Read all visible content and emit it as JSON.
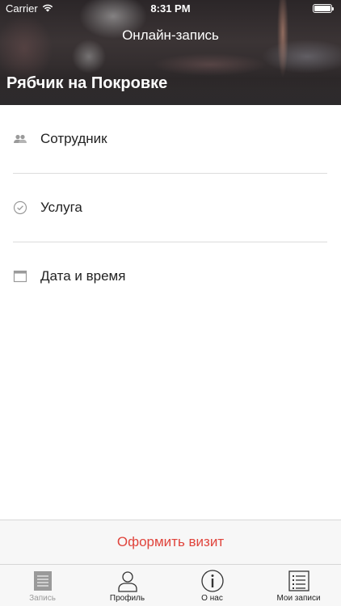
{
  "status_bar": {
    "carrier": "Carrier",
    "time": "8:31 PM",
    "wifi_icon": "wifi-icon",
    "battery_icon": "battery-icon"
  },
  "header": {
    "nav_title": "Онлайн-запись",
    "venue_name": "Рябчик на Покровке"
  },
  "booking_options": [
    {
      "label": "Сотрудник",
      "icon": "people-icon"
    },
    {
      "label": "Услуга",
      "icon": "check-circle-icon"
    },
    {
      "label": "Дата и время",
      "icon": "calendar-icon"
    }
  ],
  "action": {
    "label": "Оформить визит",
    "color": "#e0443c"
  },
  "tab_bar": {
    "tabs": [
      {
        "label": "Запись",
        "icon": "document-icon",
        "active": true
      },
      {
        "label": "Профиль",
        "icon": "person-icon",
        "active": false
      },
      {
        "label": "О нас",
        "icon": "info-icon",
        "active": false
      },
      {
        "label": "Мои записи",
        "icon": "list-icon",
        "active": false
      }
    ]
  }
}
